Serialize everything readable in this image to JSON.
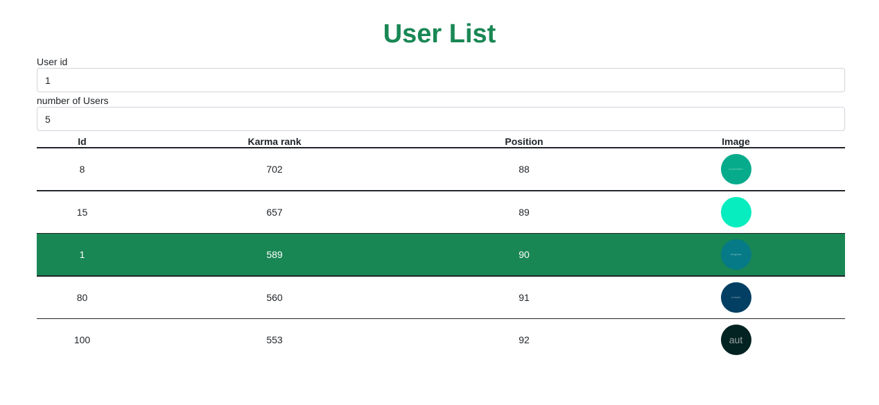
{
  "page": {
    "title": "User List",
    "accent_color": "#198754"
  },
  "form": {
    "user_id_label": "User id",
    "user_id_value": "1",
    "num_users_label": "number of Users",
    "num_users_value": "5"
  },
  "table": {
    "headers": [
      "Id",
      "Karma rank",
      "Position",
      "Image"
    ],
    "rows": [
      {
        "id": "8",
        "karma": "702",
        "position": "88",
        "avatar_color": "#06ab8b",
        "avatar_text": "consectetur"
      },
      {
        "id": "15",
        "karma": "657",
        "position": "89",
        "avatar_color": "#07edbf",
        "avatar_text": ""
      },
      {
        "id": "1",
        "karma": "589",
        "position": "90",
        "avatar_color": "#067a86",
        "avatar_text": "doughlas",
        "selected": true
      },
      {
        "id": "80",
        "karma": "560",
        "position": "91",
        "avatar_color": "#023f63",
        "avatar_text": "veritatis"
      },
      {
        "id": "100",
        "karma": "553",
        "position": "92",
        "avatar_color": "#032222",
        "avatar_text": "aut"
      }
    ]
  }
}
